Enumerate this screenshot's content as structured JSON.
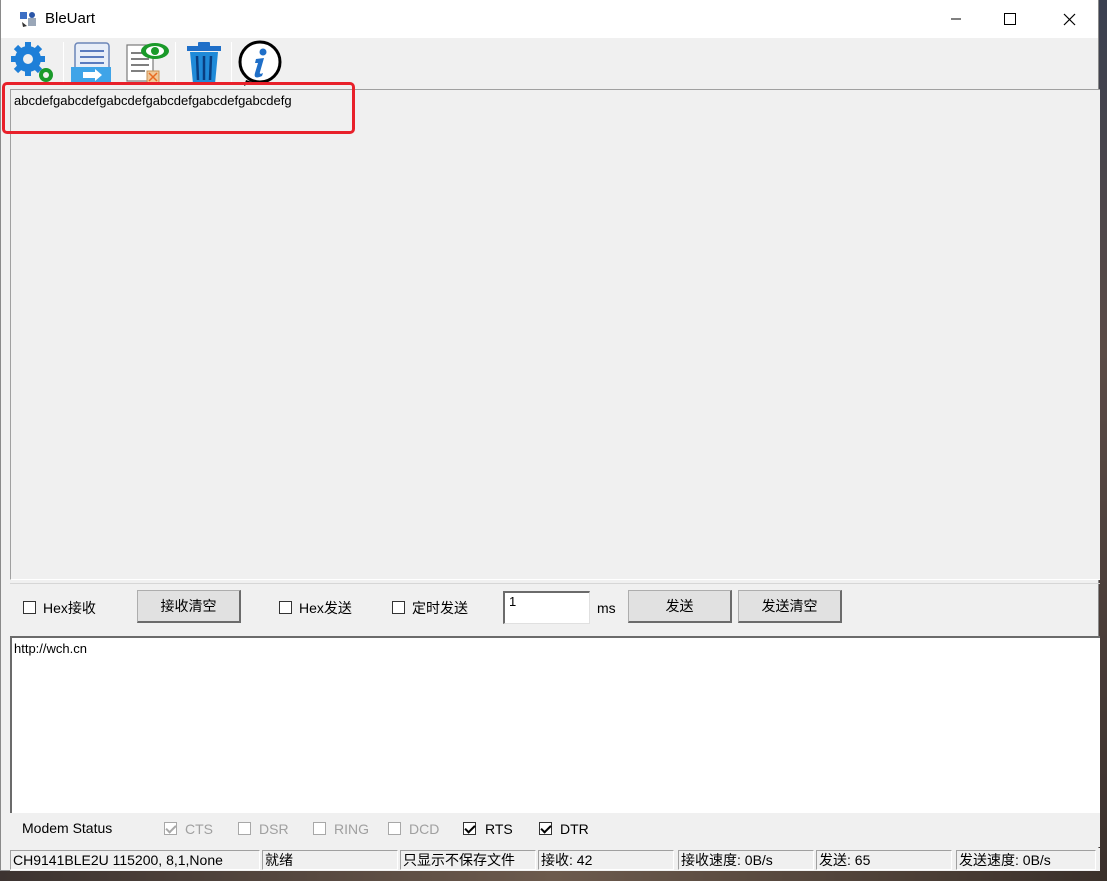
{
  "window": {
    "title": "BleUart"
  },
  "toolbar": {
    "items": [
      {
        "icon": "gear-icon"
      },
      {
        "icon": "send-file-icon"
      },
      {
        "icon": "view-file-icon"
      },
      {
        "icon": "trash-icon"
      },
      {
        "icon": "info-icon"
      }
    ]
  },
  "receive": {
    "text": "abcdefgabcdefgabcdefgabcdefgabcdefgabcdefg"
  },
  "controls": {
    "hex_receive_label": "Hex接收",
    "hex_receive_checked": false,
    "clear_receive_label": "接收清空",
    "hex_send_label": "Hex发送",
    "hex_send_checked": false,
    "timed_send_label": "定时发送",
    "timed_send_checked": false,
    "interval_value": "1",
    "interval_unit": "ms",
    "send_label": "发送",
    "clear_send_label": "发送清空"
  },
  "send": {
    "text": "http://wch.cn"
  },
  "modem": {
    "label": "Modem Status",
    "signals": [
      {
        "name": "CTS",
        "checked": true,
        "enabled": false
      },
      {
        "name": "DSR",
        "checked": false,
        "enabled": false
      },
      {
        "name": "RING",
        "checked": false,
        "enabled": false
      },
      {
        "name": "DCD",
        "checked": false,
        "enabled": false
      },
      {
        "name": "RTS",
        "checked": true,
        "enabled": true
      },
      {
        "name": "DTR",
        "checked": true,
        "enabled": true
      }
    ]
  },
  "status": {
    "port": "CH9141BLE2U 115200, 8,1,None",
    "state": "就绪",
    "mode": "只显示不保存文件",
    "received": "接收: 42",
    "recv_speed": "接收速度: 0B/s",
    "sent": "发送: 65",
    "send_speed": "发送速度: 0B/s"
  },
  "colors": {
    "highlight": "#e8202a",
    "window_bg": "#f0f0f0"
  }
}
